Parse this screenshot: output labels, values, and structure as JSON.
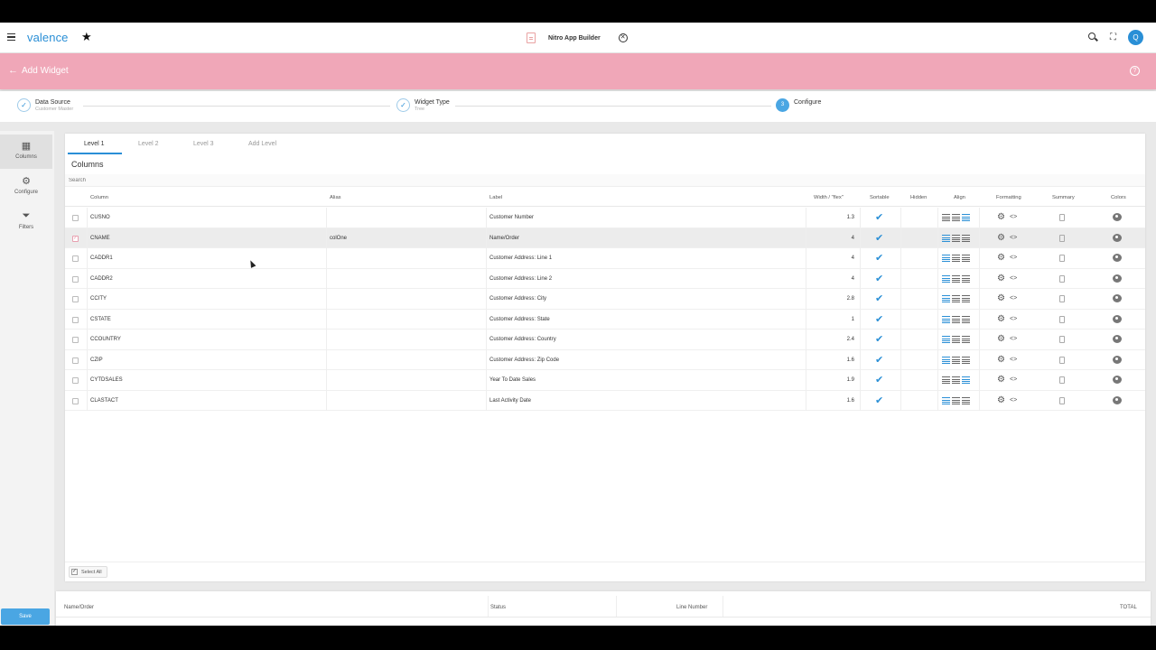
{
  "topbar": {
    "brand": "valence",
    "app_name": "Nitro App Builder",
    "avatar_initial": "Q"
  },
  "header": {
    "title": "Add Widget",
    "color": "#f0a7b8"
  },
  "stepper": {
    "steps": [
      {
        "label": "Data Source",
        "sub": "Customer Master",
        "state": "done"
      },
      {
        "label": "Widget Type",
        "sub": "Tree",
        "state": "done"
      },
      {
        "label": "Configure",
        "sub": "",
        "number": "3",
        "state": "active"
      }
    ]
  },
  "rail": {
    "items": [
      {
        "label": "Columns",
        "icon": "grid-icon"
      },
      {
        "label": "Configure",
        "icon": "gear-icon"
      },
      {
        "label": "Filters",
        "icon": "filter-icon"
      }
    ],
    "save_label": "Save"
  },
  "tabs": [
    "Level 1",
    "Level 2",
    "Level 3",
    "Add Level"
  ],
  "section_title": "Columns",
  "search_placeholder": "Search",
  "table": {
    "headers": {
      "column": "Column",
      "alias": "Alias",
      "label": "Label",
      "width": "Width / \"flex\"",
      "sortable": "Sortable",
      "hidden": "Hidden",
      "align": "Align",
      "formatting": "Formatting",
      "summary": "Summary",
      "colors": "Colors"
    },
    "rows": [
      {
        "column": "CUSNO",
        "alias": "",
        "label": "Customer Number",
        "width": "1.3",
        "align": "right",
        "checked": false
      },
      {
        "column": "CNAME",
        "alias": "colOne",
        "label": "Name/Order",
        "width": "4",
        "align": "left",
        "checked": true
      },
      {
        "column": "CADDR1",
        "alias": "",
        "label": "Customer Address: Line 1",
        "width": "4",
        "align": "left",
        "checked": false
      },
      {
        "column": "CADDR2",
        "alias": "",
        "label": "Customer Address: Line 2",
        "width": "4",
        "align": "left",
        "checked": false
      },
      {
        "column": "CCITY",
        "alias": "",
        "label": "Customer Address: City",
        "width": "2.8",
        "align": "left",
        "checked": false
      },
      {
        "column": "CSTATE",
        "alias": "",
        "label": "Customer Address: State",
        "width": "1",
        "align": "left",
        "checked": false
      },
      {
        "column": "CCOUNTRY",
        "alias": "",
        "label": "Customer Address: Country",
        "width": "2.4",
        "align": "left",
        "checked": false
      },
      {
        "column": "CZIP",
        "alias": "",
        "label": "Customer Address: Zip Code",
        "width": "1.6",
        "align": "left",
        "checked": false
      },
      {
        "column": "CYTDSALES",
        "alias": "",
        "label": "Year To Date Sales",
        "width": "1.9",
        "align": "right",
        "checked": false
      },
      {
        "column": "CLASTACT",
        "alias": "",
        "label": "Last Activity Date",
        "width": "1.6",
        "align": "left",
        "checked": false
      }
    ]
  },
  "select_all_label": "Select All",
  "preview": {
    "headers": [
      "Name/Order",
      "Status",
      "Line Number",
      "TOTAL"
    ]
  },
  "colors": {
    "accent": "#2a8fd6",
    "header_pink": "#f0a7b8"
  }
}
